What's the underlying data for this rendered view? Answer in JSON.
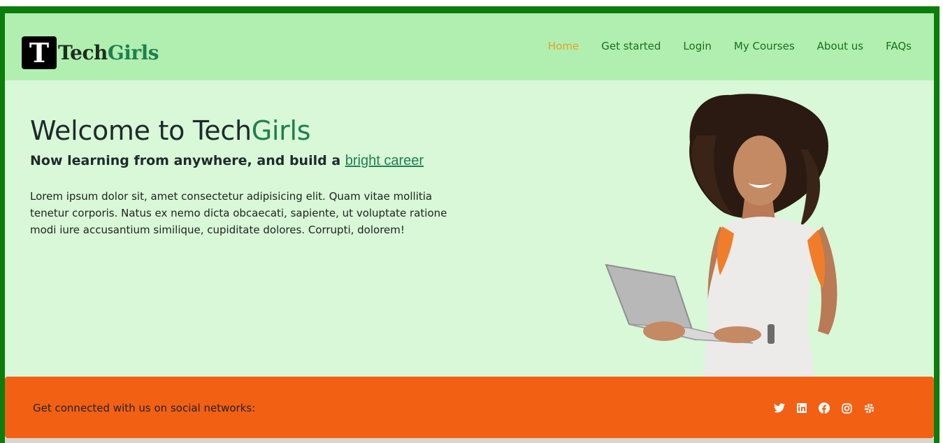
{
  "brand": {
    "logo_letter": "T",
    "name_part1": "Tech",
    "name_part2": "Girls"
  },
  "nav": {
    "items": [
      {
        "label": "Home",
        "active": true
      },
      {
        "label": "Get started",
        "active": false
      },
      {
        "label": "Login",
        "active": false
      },
      {
        "label": "My Courses",
        "active": false
      },
      {
        "label": "About us",
        "active": false
      },
      {
        "label": "FAQs",
        "active": false
      }
    ]
  },
  "hero": {
    "title_prefix": "Welcome to Tech",
    "title_accent": "Girls",
    "subtitle_prefix": "Now learning from anywhere, and build a ",
    "subtitle_link": "bright career",
    "paragraph": "Lorem ipsum dolor sit, amet consectetur adipisicing elit. Quam vitae mollitia tenetur corporis. Natus ex nemo dicta obcaecati, sapiente, ut voluptate ratione modi iure accusantium similique, cupiditate dolores. Corrupti, dolorem!"
  },
  "footer": {
    "social_text": "Get connected with us on social networks:",
    "social_icons": [
      "twitter-icon",
      "linkedin-icon",
      "facebook-icon",
      "instagram-icon",
      "slack-icon"
    ]
  },
  "colors": {
    "frame": "#0a7d0a",
    "navbar_bg": "#b0efb0",
    "page_bg": "#d8f8d8",
    "accent_green": "#1f7f4f",
    "nav_active": "#e8a020",
    "footer_bg": "#f26013"
  }
}
